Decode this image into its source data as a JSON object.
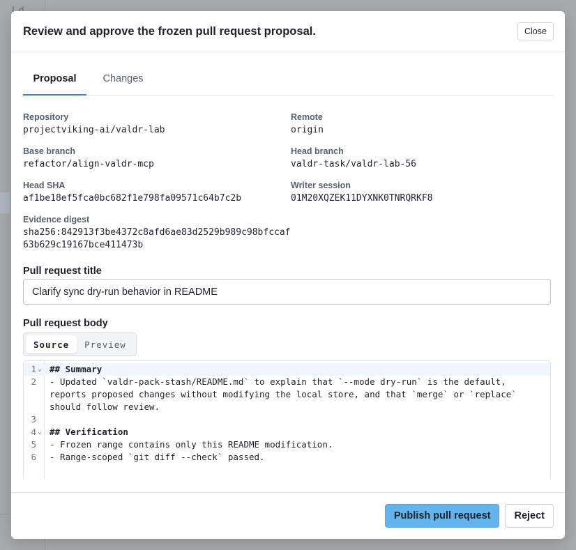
{
  "background": {
    "glyph": "Ld"
  },
  "modal": {
    "title": "Review and approve the frozen pull request proposal.",
    "close_label": "Close",
    "tabs": [
      {
        "label": "Proposal",
        "active": true
      },
      {
        "label": "Changes",
        "active": false
      }
    ],
    "meta": {
      "repository": {
        "label": "Repository",
        "value": "projectviking-ai/valdr-lab"
      },
      "remote": {
        "label": "Remote",
        "value": "origin"
      },
      "base_branch": {
        "label": "Base branch",
        "value": "refactor/align-valdr-mcp"
      },
      "head_branch": {
        "label": "Head branch",
        "value": "valdr-task/valdr-lab-56"
      },
      "head_sha": {
        "label": "Head SHA",
        "value": "af1be18ef5fca0bc682f1e798fa09571c64b7c2b"
      },
      "writer_session": {
        "label": "Writer session",
        "value": "01M20XQZEK11DYXNK0TNRQRKF8"
      },
      "evidence_digest": {
        "label": "Evidence digest",
        "value": "sha256:842913f3be4372c8afd6ae83d2529b989c98bfccaf63b629c19167bce411473b"
      }
    },
    "pr_title": {
      "label": "Pull request title",
      "value": "Clarify sync dry-run behavior in README"
    },
    "pr_body": {
      "label": "Pull request body",
      "modes": [
        {
          "label": "Source",
          "active": true
        },
        {
          "label": "Preview",
          "active": false
        }
      ],
      "lines": [
        {
          "num": "1",
          "fold": true,
          "text": "## Summary",
          "heading": true
        },
        {
          "num": "2",
          "fold": false,
          "text": "- Updated `valdr-pack-stash/README.md` to explain that `--mode dry-run` is the default,",
          "heading": false
        },
        {
          "num": "",
          "fold": false,
          "text": "reports proposed changes without modifying the local store, and that `merge` or `replace`",
          "heading": false
        },
        {
          "num": "",
          "fold": false,
          "text": "should follow review.",
          "heading": false
        },
        {
          "num": "3",
          "fold": false,
          "text": "",
          "heading": false
        },
        {
          "num": "4",
          "fold": true,
          "text": "## Verification",
          "heading": true
        },
        {
          "num": "5",
          "fold": false,
          "text": "- Frozen range contains only this README modification.",
          "heading": false
        },
        {
          "num": "6",
          "fold": false,
          "text": "- Range-scoped `git diff --check` passed.",
          "heading": false
        }
      ]
    },
    "footer": {
      "publish_label": "Publish pull request",
      "reject_label": "Reject"
    }
  },
  "colors": {
    "accent": "#2f81f7",
    "primary_button": "#63b3ed",
    "overlay": "#a4a5a7"
  }
}
